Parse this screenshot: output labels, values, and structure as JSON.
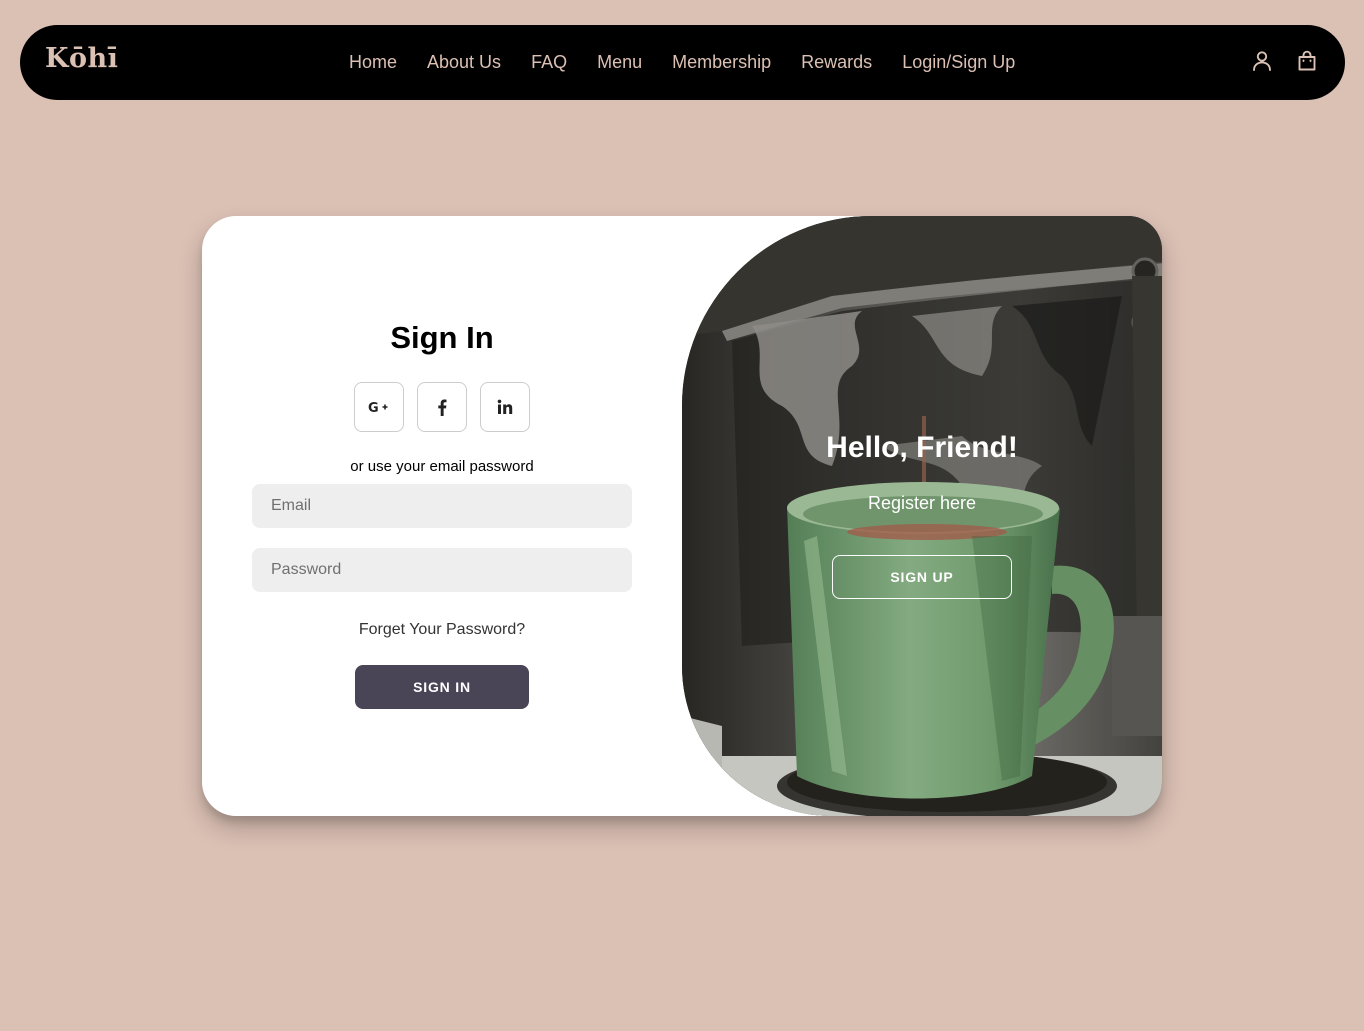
{
  "brand": {
    "logo_text": "Kōhī"
  },
  "nav": {
    "links": [
      "Home",
      "About Us",
      "FAQ",
      "Menu",
      "Membership",
      "Rewards",
      "Login/Sign Up"
    ],
    "icons": [
      "user-icon",
      "shopping-bag-icon"
    ]
  },
  "signin": {
    "title": "Sign In",
    "social": [
      {
        "name": "google-plus",
        "label": "G+"
      },
      {
        "name": "facebook",
        "label": "f"
      },
      {
        "name": "linkedin",
        "label": "in"
      }
    ],
    "alt_text": "or use your email password",
    "email_placeholder": "Email",
    "password_placeholder": "Password",
    "forgot_label": "Forget Your Password?",
    "button_label": "SIGN IN"
  },
  "signup_panel": {
    "title": "Hello, Friend!",
    "subtitle": "Register here",
    "button_label": "SIGN UP"
  },
  "colors": {
    "page_background": "#dbc0b4",
    "navbar_background": "#000000",
    "nav_text": "#dbc0b4",
    "card_background": "#ffffff",
    "signin_button": "#4a4556",
    "input_background": "#eeeeee"
  }
}
